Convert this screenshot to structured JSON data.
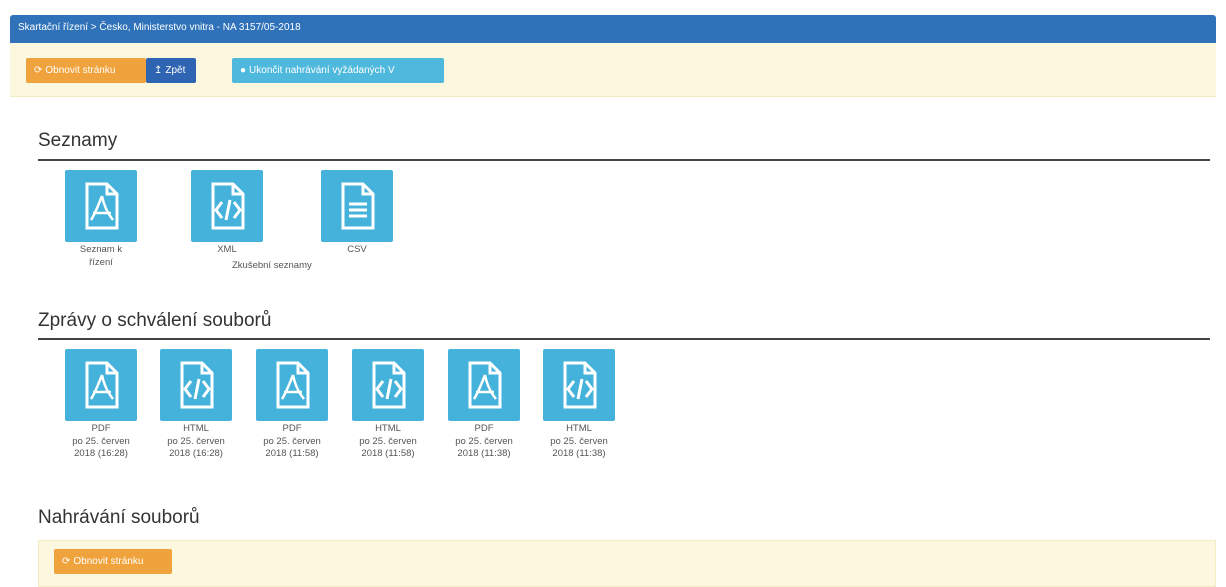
{
  "header": {
    "breadcrumb": "Skartační řízení > Česko, Ministerstvo vnitra - NA 3157/05-2018"
  },
  "toolbar": {
    "refresh_label": "Obnovit stránku",
    "back_label": "Zpět",
    "finish_label": "Ukončit nahrávání vyžádaných V"
  },
  "sections": {
    "lists_title": "Seznamy",
    "lists_items": [
      {
        "type": "pdf",
        "label1": "Seznam k",
        "label2": "řízení"
      },
      {
        "type": "code",
        "label1": "XML"
      },
      {
        "type": "doc",
        "label1": "CSV"
      }
    ],
    "lists_caption": "Zkušební seznamy",
    "reports_title": "Zprávy o schválení souborů",
    "reports_items": [
      {
        "type": "pdf",
        "l1": "PDF",
        "l2": "po 25. červen",
        "l3": "2018 (16:28)"
      },
      {
        "type": "code",
        "l1": "HTML",
        "l2": "po 25. červen",
        "l3": "2018 (16:28)"
      },
      {
        "type": "pdf",
        "l1": "PDF",
        "l2": "po 25. červen",
        "l3": "2018 (11:58)"
      },
      {
        "type": "code",
        "l1": "HTML",
        "l2": "po 25. červen",
        "l3": "2018 (11:58)"
      },
      {
        "type": "pdf",
        "l1": "PDF",
        "l2": "po 25. červen",
        "l3": "2018 (11:38)"
      },
      {
        "type": "code",
        "l1": "HTML",
        "l2": "po 25. červen",
        "l3": "2018 (11:38)"
      }
    ],
    "upload_title": "Nahrávání souborů",
    "upload_refresh_label": "Obnovit stránku"
  },
  "colors": {
    "header_bg": "#2f72b9",
    "toolbar_bg": "#fcf8df",
    "tile": "#44b2da",
    "orange": "#f0a23c"
  }
}
